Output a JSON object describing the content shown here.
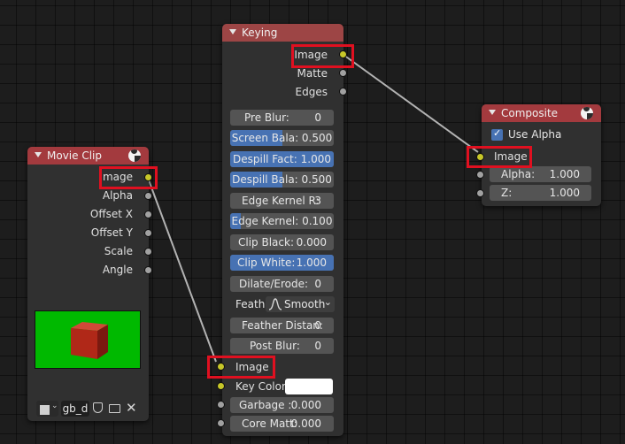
{
  "movie_clip": {
    "title": "Movie Clip",
    "outputs": [
      "Image",
      "Alpha",
      "Offset X",
      "Offset Y",
      "Scale",
      "Angle"
    ],
    "clip_name": "gb_d"
  },
  "keying": {
    "title": "Keying",
    "outputs": [
      "Image",
      "Matte",
      "Edges"
    ],
    "fields": [
      {
        "label": "Pre Blur:",
        "value": "0",
        "fill": 0
      },
      {
        "label": "Screen Bala: 0.500",
        "value": "",
        "fill": 0.5
      },
      {
        "label": "Despill Fact: 1.000",
        "value": "",
        "fill": 1.0
      },
      {
        "label": "Despill Bala: 0.500",
        "value": "",
        "fill": 0.5
      },
      {
        "label": "Edge Kernel R:",
        "value": "3",
        "fill": 0
      },
      {
        "label": "Edge Kernel: 0.100",
        "value": "",
        "fill": 0.1
      },
      {
        "label": "Clip Black:",
        "value": "0.000",
        "fill": 0
      },
      {
        "label": "Clip White:",
        "value": "1.000",
        "fill": 1.0
      },
      {
        "label": "Dilate/Erode:",
        "value": "0",
        "fill": 0
      }
    ],
    "feather_label": "Feath",
    "feather_value": "Smooth",
    "fields2": [
      {
        "label": "Feather Distan:",
        "value": "0"
      },
      {
        "label": "Post Blur:",
        "value": "0"
      }
    ],
    "inputs": {
      "image": "Image",
      "key_color": "Key Color",
      "garbage_label": "Garbage :",
      "garbage_value": "0.000",
      "core_label": "Core Matt:",
      "core_value": "0.000"
    }
  },
  "composite": {
    "title": "Composite",
    "use_alpha_label": "Use Alpha",
    "use_alpha_checked": true,
    "image_label": "Image",
    "alpha_label": "Alpha:",
    "alpha_value": "1.000",
    "z_label": "Z:",
    "z_value": "1.000"
  },
  "colors": {
    "matte_header": "#9d4545",
    "output_header": "#a33a3e",
    "slider_fill": "#4772b3",
    "socket_image": "#c7c729",
    "socket_value": "#a1a1a1",
    "highlight": "#e01020",
    "preview_green": "#00b900",
    "cube_red": "#b02818"
  }
}
